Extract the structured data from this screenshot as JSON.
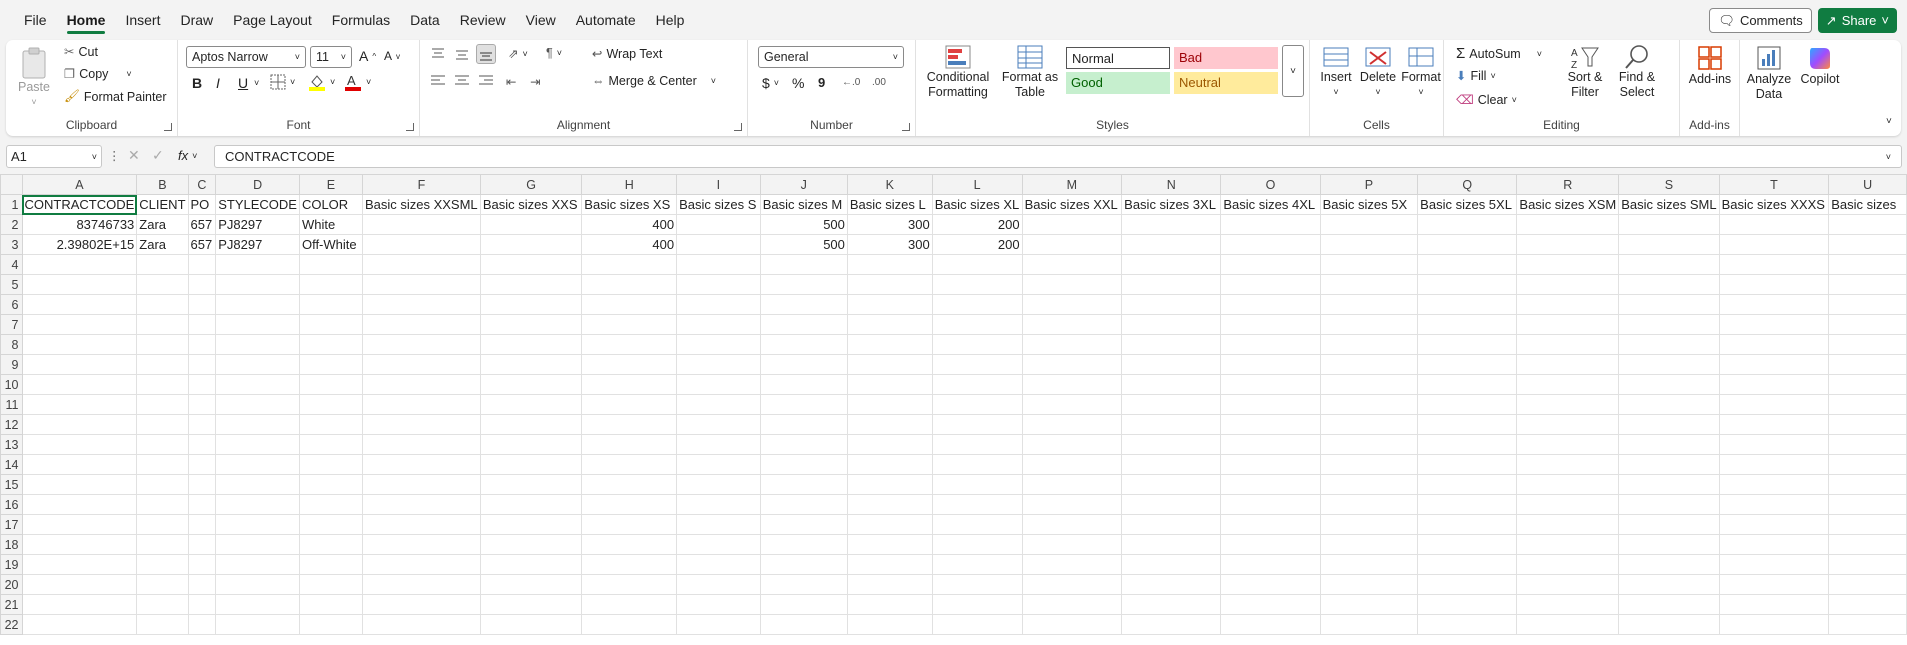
{
  "menu": {
    "tabs": [
      "File",
      "Home",
      "Insert",
      "Draw",
      "Page Layout",
      "Formulas",
      "Data",
      "Review",
      "View",
      "Automate",
      "Help"
    ],
    "active": "Home",
    "comments": "Comments",
    "share": "Share"
  },
  "ribbon": {
    "clipboard": {
      "label": "Clipboard",
      "paste": "Paste",
      "cut": "Cut",
      "copy": "Copy",
      "format_painter": "Format Painter"
    },
    "font": {
      "label": "Font",
      "family": "Aptos Narrow",
      "size": "11",
      "bold": "B",
      "italic": "I",
      "underline": "U"
    },
    "alignment": {
      "label": "Alignment",
      "wrap": "Wrap Text",
      "merge": "Merge & Center"
    },
    "number": {
      "label": "Number",
      "format": "General",
      "currency": "$",
      "percent": "%",
      "comma": "9"
    },
    "styles": {
      "label": "Styles",
      "conditional": "Conditional\nFormatting",
      "format_table": "Format as\nTable",
      "normal": "Normal",
      "bad": "Bad",
      "good": "Good",
      "neutral": "Neutral"
    },
    "cells": {
      "label": "Cells",
      "insert": "Insert",
      "delete": "Delete",
      "format": "Format"
    },
    "editing": {
      "label": "Editing",
      "autosum": "AutoSum",
      "fill": "Fill",
      "clear": "Clear",
      "sort": "Sort &\nFilter",
      "find": "Find &\nSelect"
    },
    "addins": {
      "label": "Add-ins",
      "addins": "Add-ins"
    },
    "analyze": "Analyze\nData",
    "copilot": "Copilot"
  },
  "formula_bar": {
    "name_box": "A1",
    "fx": "fx",
    "value": "CONTRACTCODE"
  },
  "sheet": {
    "columns": [
      "A",
      "B",
      "C",
      "D",
      "E",
      "F",
      "G",
      "H",
      "I",
      "J",
      "K",
      "L",
      "M",
      "N",
      "O",
      "P",
      "Q",
      "R",
      "S",
      "T",
      "U"
    ],
    "rows": [
      [
        "CONTRACTCODE",
        "CLIENT",
        "PO",
        "STYLECODE",
        "COLOR",
        "Basic sizes XXSML",
        "Basic sizes XXS",
        "Basic sizes XS",
        "Basic sizes S",
        "Basic sizes M",
        "Basic sizes L",
        "Basic sizes XL",
        "Basic sizes XXL",
        "Basic sizes 3XL",
        "Basic sizes 4XL",
        "Basic sizes 5X",
        "Basic sizes 5XL",
        "Basic sizes XSM",
        "Basic sizes SML",
        "Basic sizes XXXS",
        "Basic sizes"
      ],
      [
        "83746733",
        "Zara",
        "657",
        "PJ8297",
        "White",
        "",
        "",
        "400",
        "",
        "500",
        "300",
        "200",
        "",
        "",
        "",
        "",
        "",
        "",
        "",
        "",
        ""
      ],
      [
        "2.39802E+15",
        "Zara",
        "657",
        "PJ8297",
        "Off-White",
        "",
        "",
        "400",
        "",
        "500",
        "300",
        "200",
        "",
        "",
        "",
        "",
        "",
        "",
        "",
        "",
        ""
      ]
    ],
    "row_count": 22
  },
  "colors": {
    "accent": "#107c41",
    "bad_bg": "#ffc7ce",
    "bad_fg": "#9c0006",
    "good_bg": "#c6efce",
    "good_fg": "#006100",
    "neutral_bg": "#ffeb9c",
    "neutral_fg": "#9c5700"
  }
}
